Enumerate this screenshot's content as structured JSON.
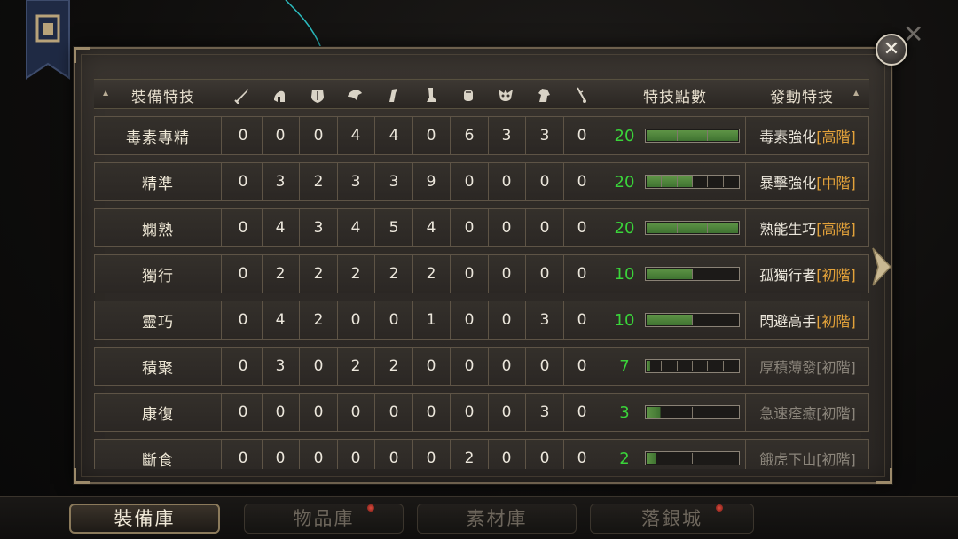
{
  "header": {
    "name_label": "裝備特技",
    "points_label": "特技點數",
    "effect_label": "發動特技",
    "piece_icons": [
      "sword-icon",
      "helmet-icon",
      "chest-icon",
      "shoulder-icon",
      "arm-icon",
      "leg-icon",
      "glove-icon",
      "mask-icon",
      "horse-icon",
      "accessory-icon"
    ]
  },
  "rows": [
    {
      "name": "毒素專精",
      "values": [
        "0",
        "0",
        "0",
        "4",
        "4",
        "0",
        "6",
        "3",
        "3",
        "0"
      ],
      "points": "20",
      "fill": 3,
      "segments": 3,
      "effect": "毒素強化",
      "tier": "[高階]",
      "active": true
    },
    {
      "name": "精準",
      "values": [
        "0",
        "3",
        "2",
        "3",
        "3",
        "9",
        "0",
        "0",
        "0",
        "0"
      ],
      "points": "20",
      "fill": 3,
      "segments": 6,
      "effect": "暴擊強化",
      "tier": "[中階]",
      "active": true
    },
    {
      "name": "嫻熟",
      "values": [
        "0",
        "4",
        "3",
        "4",
        "5",
        "4",
        "0",
        "0",
        "0",
        "0"
      ],
      "points": "20",
      "fill": 3,
      "segments": 3,
      "effect": "熟能生巧",
      "tier": "[高階]",
      "active": true
    },
    {
      "name": "獨行",
      "values": [
        "0",
        "2",
        "2",
        "2",
        "2",
        "2",
        "0",
        "0",
        "0",
        "0"
      ],
      "points": "10",
      "fill": 1,
      "segments": 2,
      "effect": "孤獨行者",
      "tier": "[初階]",
      "active": true
    },
    {
      "name": "靈巧",
      "values": [
        "0",
        "4",
        "2",
        "0",
        "0",
        "1",
        "0",
        "0",
        "3",
        "0"
      ],
      "points": "10",
      "fill": 1,
      "segments": 2,
      "effect": "閃避高手",
      "tier": "[初階]",
      "active": true
    },
    {
      "name": "積聚",
      "values": [
        "0",
        "3",
        "0",
        "2",
        "2",
        "0",
        "0",
        "0",
        "0",
        "0"
      ],
      "points": "7",
      "fill": 0.25,
      "segments": 6,
      "effect": "厚積薄發",
      "tier": "[初階]",
      "active": false
    },
    {
      "name": "康復",
      "values": [
        "0",
        "0",
        "0",
        "0",
        "0",
        "0",
        "0",
        "0",
        "3",
        "0"
      ],
      "points": "3",
      "fill": 0.3,
      "segments": 2,
      "effect": "急速痊癒",
      "tier": "[初階]",
      "active": false
    },
    {
      "name": "斷食",
      "values": [
        "0",
        "0",
        "0",
        "0",
        "0",
        "0",
        "2",
        "0",
        "0",
        "0"
      ],
      "points": "2",
      "fill": 0.2,
      "segments": 2,
      "effect": "餓虎下山",
      "tier": "[初階]",
      "active": false
    }
  ],
  "tabs": [
    {
      "label": "裝備庫",
      "active": true
    },
    {
      "label": "物品庫",
      "active": false
    },
    {
      "label": "素材庫",
      "active": false
    },
    {
      "label": "落銀城",
      "active": false
    }
  ],
  "colors": {
    "points_green": "#3ad43a",
    "tier_orange": "#e3a23a",
    "bar_green": "#4f8a3c"
  }
}
